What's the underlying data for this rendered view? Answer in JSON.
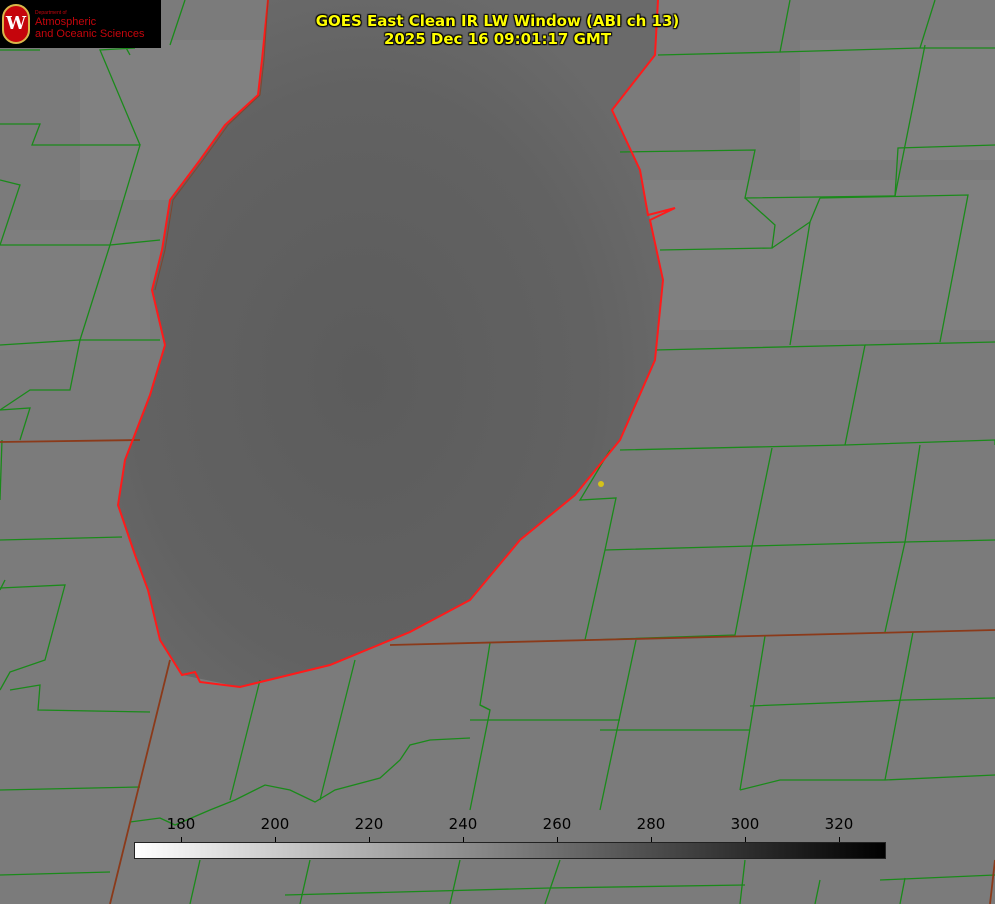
{
  "header": {
    "title_line1": "GOES East Clean IR LW Window (ABI ch 13)",
    "title_line2": "2025 Dec 16 09:01:17 GMT"
  },
  "logo": {
    "small": "Department of",
    "line1": "Atmospheric",
    "line2": "and Oceanic Sciences",
    "seal_letter": "W"
  },
  "colorbar": {
    "ticks": [
      "180",
      "200",
      "220",
      "240",
      "260",
      "280",
      "300",
      "320"
    ],
    "min": 170,
    "max": 330
  },
  "colors": {
    "county_lines": "#1a8a1a",
    "state_lines": "#8b3a1a",
    "lake_outline": "#ff1a1a",
    "title_text": "#ffff00"
  }
}
